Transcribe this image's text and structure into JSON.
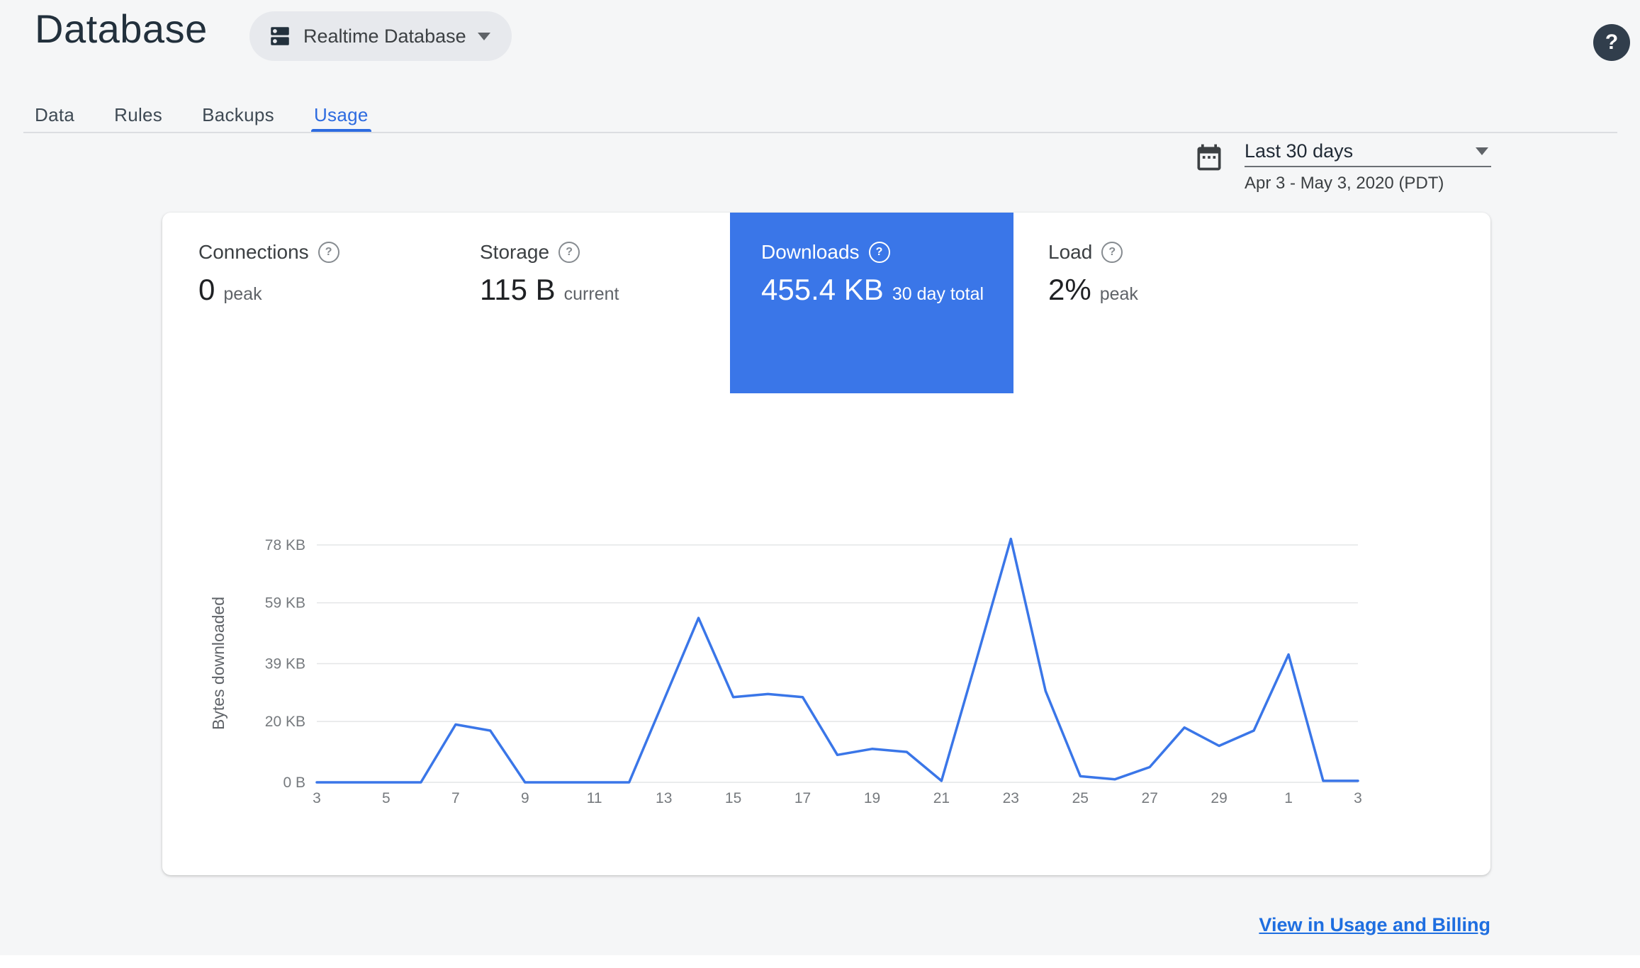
{
  "accent_color": "#3a76e8",
  "header": {
    "title": "Database",
    "database_selector": {
      "label": "Realtime Database"
    },
    "help_glyph": "?"
  },
  "tabs": {
    "items": [
      {
        "label": "Data",
        "active": false
      },
      {
        "label": "Rules",
        "active": false
      },
      {
        "label": "Backups",
        "active": false
      },
      {
        "label": "Usage",
        "active": true
      }
    ]
  },
  "date_range": {
    "selected": "Last 30 days",
    "detail": "Apr 3 - May 3, 2020 (PDT)"
  },
  "metrics": {
    "help_glyph": "?",
    "items": [
      {
        "label": "Connections",
        "value": "0",
        "unit": "peak",
        "selected": false
      },
      {
        "label": "Storage",
        "value": "115 B",
        "unit": "current",
        "selected": false
      },
      {
        "label": "Downloads",
        "value": "455.4 KB",
        "unit": "30 day total",
        "selected": true
      },
      {
        "label": "Load",
        "value": "2%",
        "unit": "peak",
        "selected": false
      }
    ]
  },
  "chart_data": {
    "type": "line",
    "title": "",
    "xlabel": "",
    "ylabel": "Bytes downloaded",
    "ylim": [
      0,
      78
    ],
    "grid": true,
    "legend": false,
    "line_color": "#3a76e8",
    "y_tick_labels": [
      "0 B",
      "20 KB",
      "39 KB",
      "59 KB",
      "78 KB"
    ],
    "y_tick_values_kb": [
      0,
      20,
      39,
      59,
      78
    ],
    "x_tick_labels": [
      "3",
      "5",
      "7",
      "9",
      "11",
      "13",
      "15",
      "17",
      "19",
      "21",
      "23",
      "25",
      "27",
      "29",
      "1",
      "3"
    ],
    "x_days": [
      "Apr 3",
      "Apr 4",
      "Apr 5",
      "Apr 6",
      "Apr 7",
      "Apr 8",
      "Apr 9",
      "Apr 10",
      "Apr 11",
      "Apr 12",
      "Apr 13",
      "Apr 14",
      "Apr 15",
      "Apr 16",
      "Apr 17",
      "Apr 18",
      "Apr 19",
      "Apr 20",
      "Apr 21",
      "Apr 22",
      "Apr 23",
      "Apr 24",
      "Apr 25",
      "Apr 26",
      "Apr 27",
      "Apr 28",
      "Apr 29",
      "Apr 30",
      "May 1",
      "May 2",
      "May 3"
    ],
    "values_kb": [
      0,
      0,
      0,
      0,
      19,
      17,
      0,
      0,
      0,
      0,
      27,
      54,
      28,
      29,
      28,
      9,
      11,
      10,
      0.5,
      40,
      80,
      30,
      2,
      1,
      5,
      18,
      12,
      17,
      42,
      0.5,
      0.5
    ]
  },
  "footer": {
    "link_label": "View in Usage and Billing"
  }
}
